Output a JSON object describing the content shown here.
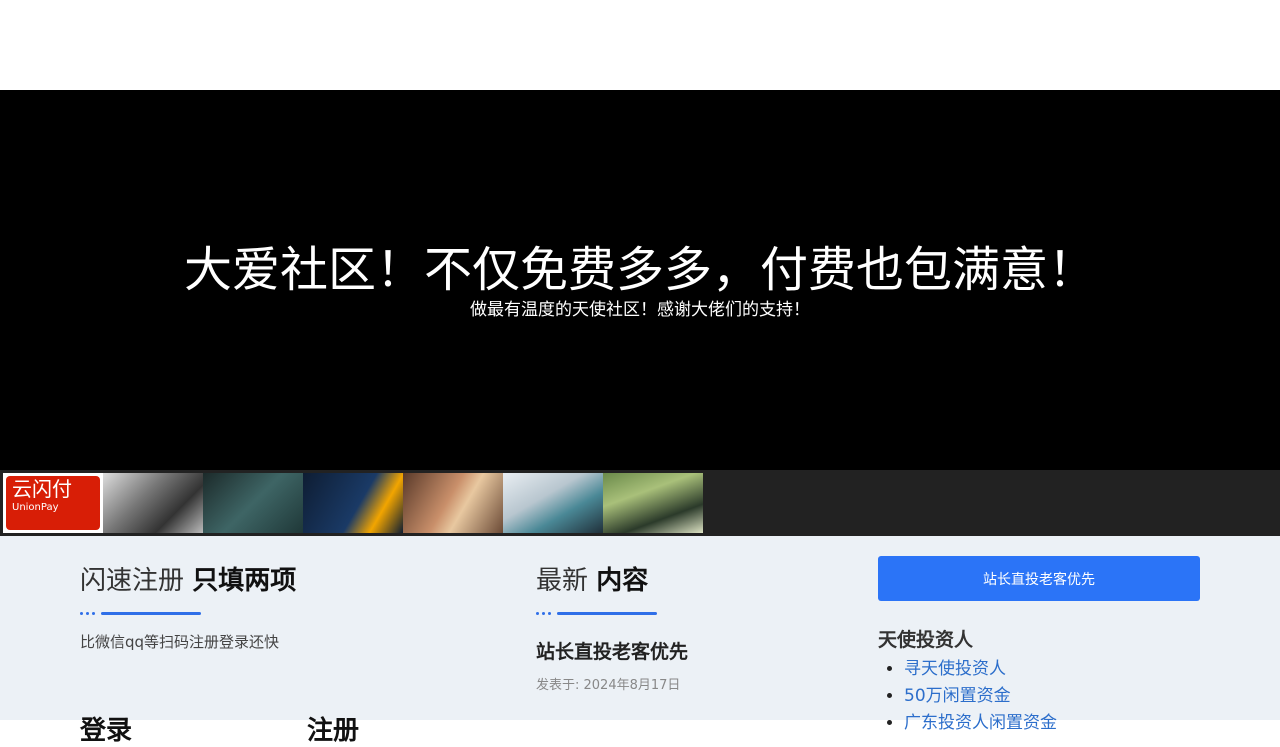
{
  "hero": {
    "title": "大爱社区！不仅免费多多，付费也包满意！",
    "subtitle": "做最有温度的天使社区！感谢大佬们的支持！"
  },
  "thumbnails": [
    {
      "name": "unionpay-thumb",
      "text": "云闪付",
      "sub": "UnionPay"
    },
    {
      "name": "nest-eggs-thumb"
    },
    {
      "name": "team-icon-thumb"
    },
    {
      "name": "web-background-thumb"
    },
    {
      "name": "woman-tablet-thumb"
    },
    {
      "name": "woman-headphones-thumb"
    },
    {
      "name": "students-thumb"
    }
  ],
  "register": {
    "heading_light": "闪速注册",
    "heading_bold": "只填两项",
    "desc": "比微信qq等扫码注册登录还快",
    "login_tab": "登录",
    "register_tab": "注册"
  },
  "latest": {
    "heading_light": "最新",
    "heading_bold": "内容",
    "post_title": "站长直投老客优先",
    "post_date": "发表于: 2024年8月17日"
  },
  "sidebar": {
    "button_label": "站长直投老客优先",
    "title": "天使投资人",
    "links": [
      "寻天使投资人",
      "50万闲置资金",
      "广东投资人闲置资金"
    ]
  },
  "colors": {
    "accent": "#2b74f7",
    "hero_bg": "#000000",
    "content_bg": "#ecf1f6"
  }
}
